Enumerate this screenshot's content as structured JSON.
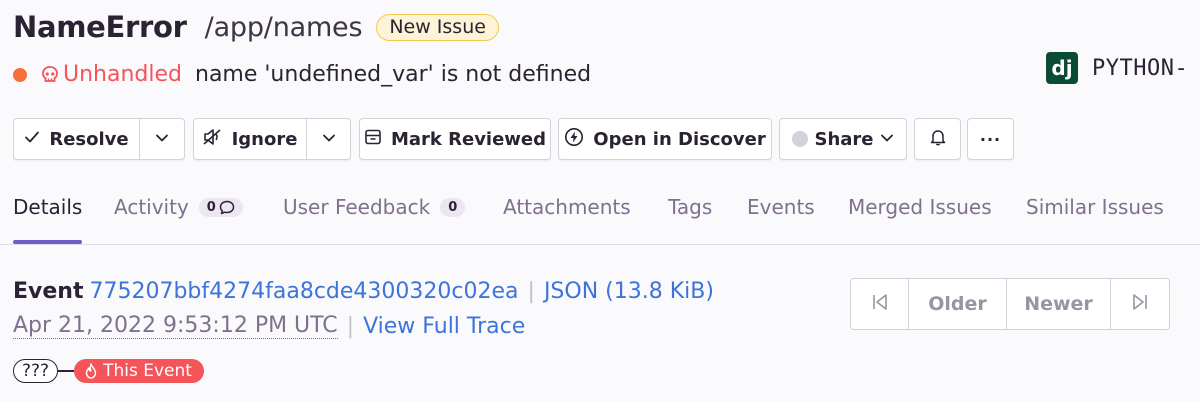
{
  "issue": {
    "title": "NameError",
    "culprit": "/app/names",
    "badge": "New Issue",
    "status": "Unhandled",
    "message": "name 'undefined_var' is not defined",
    "platform_logo": "dj",
    "platform": "PYTHON-"
  },
  "toolbar": {
    "resolve": "Resolve",
    "ignore": "Ignore",
    "mark_reviewed": "Mark Reviewed",
    "open_discover": "Open in Discover",
    "share": "Share",
    "more": "···"
  },
  "tabs": [
    {
      "label": "Details"
    },
    {
      "label": "Activity",
      "count": "0"
    },
    {
      "label": "User Feedback",
      "count": "0"
    },
    {
      "label": "Attachments"
    },
    {
      "label": "Tags"
    },
    {
      "label": "Events"
    },
    {
      "label": "Merged Issues"
    },
    {
      "label": "Similar Issues"
    }
  ],
  "event": {
    "label": "Event",
    "id": "775207bbf4274faa8cde4300320c02ea",
    "separator": "|",
    "json": "JSON (13.8 KiB)",
    "date": "Apr 21, 2022 9:53:12 PM UTC",
    "view_trace": "View Full Trace"
  },
  "pager": {
    "older": "Older",
    "newer": "Newer"
  },
  "trace": {
    "unknown": "???",
    "this_event": "This Event"
  },
  "colors": {
    "accent": "#6c5fc7",
    "link": "#3d74db",
    "error": "#f55459",
    "status_dot": "#f5703a",
    "badge_border": "#f2c94c"
  },
  "icons": [
    "skull-icon",
    "checkmark-icon",
    "chevron-down-icon",
    "mute-icon",
    "archive-icon",
    "lightning-icon",
    "bell-icon",
    "chat-bubble-icon",
    "first-page-icon",
    "last-page-icon",
    "fire-icon"
  ]
}
